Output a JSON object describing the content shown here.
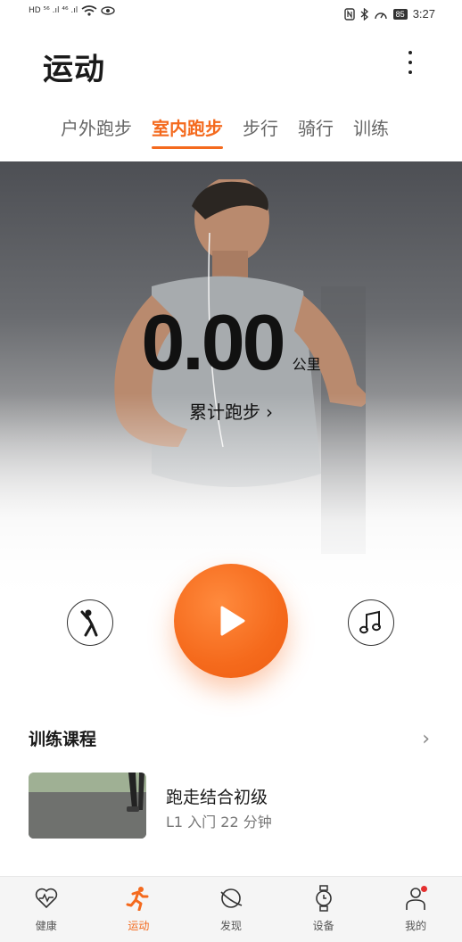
{
  "status_bar": {
    "left_text": "HD ⁵⁶ .ıl ⁴⁶ .ıl",
    "battery": "85",
    "time": "3:27"
  },
  "header": {
    "title": "运动",
    "more_icon": "more-vertical-icon"
  },
  "tabs": [
    {
      "label": "户外跑步",
      "active": false
    },
    {
      "label": "室内跑步",
      "active": true
    },
    {
      "label": "步行",
      "active": false
    },
    {
      "label": "骑行",
      "active": false
    },
    {
      "label": "训练",
      "active": false
    }
  ],
  "hero": {
    "distance_value": "0.00",
    "distance_unit": "公里",
    "total_link": "累计跑步",
    "total_link_chevron": "›"
  },
  "controls": {
    "warmup_icon": "stretch-figure-icon",
    "start_icon": "play-icon",
    "music_icon": "music-note-icon"
  },
  "courses": {
    "section_title": "训练课程",
    "section_more": "›",
    "items": [
      {
        "name": "跑走结合初级",
        "meta": "L1 入门   22 分钟"
      }
    ]
  },
  "bottom_nav": [
    {
      "label": "健康",
      "icon": "heart-pulse-icon",
      "active": false
    },
    {
      "label": "运动",
      "icon": "runner-icon",
      "active": true
    },
    {
      "label": "发现",
      "icon": "planet-icon",
      "active": false
    },
    {
      "label": "设备",
      "icon": "watch-icon",
      "active": false
    },
    {
      "label": "我的",
      "icon": "person-icon",
      "active": false,
      "badge": true
    }
  ],
  "colors": {
    "accent": "#f46a1e",
    "badge": "#e53030"
  }
}
